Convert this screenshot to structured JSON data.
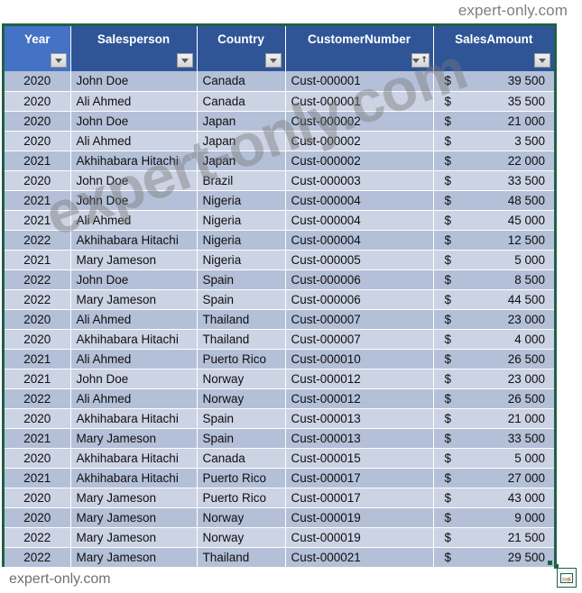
{
  "branding": {
    "top_watermark": "expert-only.com",
    "diagonal_watermark": "expert-only.com",
    "bottom_watermark": "expert-only.com"
  },
  "colors": {
    "header_blue": "#2F5597",
    "active_header_blue": "#4472C4",
    "band_dark": "#B4C0D8",
    "band_light": "#CCD3E4",
    "selection_border": "#1F6148"
  },
  "table": {
    "columns": [
      {
        "label": "Year",
        "key": "year",
        "filter": "filter-dropdown",
        "sorted": false,
        "active": true
      },
      {
        "label": "Salesperson",
        "key": "salesperson",
        "filter": "filter-dropdown",
        "sorted": false,
        "active": false
      },
      {
        "label": "Country",
        "key": "country",
        "filter": "filter-dropdown",
        "sorted": false,
        "active": false
      },
      {
        "label": "CustomerNumber",
        "key": "customer_number",
        "filter": "filter-dropdown-sorted-ascending",
        "sorted": true,
        "active": false
      },
      {
        "label": "SalesAmount",
        "key": "sales_amount",
        "filter": "filter-dropdown",
        "sorted": false,
        "active": false
      }
    ],
    "currency_symbol": "$",
    "rows": [
      {
        "year": "2020",
        "salesperson": "John Doe",
        "country": "Canada",
        "customer_number": "Cust-000001",
        "sales_amount": "39 500"
      },
      {
        "year": "2020",
        "salesperson": "Ali Ahmed",
        "country": "Canada",
        "customer_number": "Cust-000001",
        "sales_amount": "35 500"
      },
      {
        "year": "2020",
        "salesperson": "John Doe",
        "country": "Japan",
        "customer_number": "Cust-000002",
        "sales_amount": "21 000"
      },
      {
        "year": "2020",
        "salesperson": "Ali Ahmed",
        "country": "Japan",
        "customer_number": "Cust-000002",
        "sales_amount": "3 500"
      },
      {
        "year": "2021",
        "salesperson": "Akhihabara Hitachi",
        "country": "Japan",
        "customer_number": "Cust-000002",
        "sales_amount": "22 000"
      },
      {
        "year": "2020",
        "salesperson": "John Doe",
        "country": "Brazil",
        "customer_number": "Cust-000003",
        "sales_amount": "33 500"
      },
      {
        "year": "2021",
        "salesperson": "John Doe",
        "country": "Nigeria",
        "customer_number": "Cust-000004",
        "sales_amount": "48 500"
      },
      {
        "year": "2021",
        "salesperson": "Ali Ahmed",
        "country": "Nigeria",
        "customer_number": "Cust-000004",
        "sales_amount": "45 000"
      },
      {
        "year": "2022",
        "salesperson": "Akhihabara Hitachi",
        "country": "Nigeria",
        "customer_number": "Cust-000004",
        "sales_amount": "12 500"
      },
      {
        "year": "2021",
        "salesperson": "Mary Jameson",
        "country": "Nigeria",
        "customer_number": "Cust-000005",
        "sales_amount": "5 000"
      },
      {
        "year": "2022",
        "salesperson": "John Doe",
        "country": "Spain",
        "customer_number": "Cust-000006",
        "sales_amount": "8 500"
      },
      {
        "year": "2022",
        "salesperson": "Mary Jameson",
        "country": "Spain",
        "customer_number": "Cust-000006",
        "sales_amount": "44 500"
      },
      {
        "year": "2020",
        "salesperson": "Ali Ahmed",
        "country": "Thailand",
        "customer_number": "Cust-000007",
        "sales_amount": "23 000"
      },
      {
        "year": "2020",
        "salesperson": "Akhihabara Hitachi",
        "country": "Thailand",
        "customer_number": "Cust-000007",
        "sales_amount": "4 000"
      },
      {
        "year": "2021",
        "salesperson": "Ali Ahmed",
        "country": "Puerto Rico",
        "customer_number": "Cust-000010",
        "sales_amount": "26 500"
      },
      {
        "year": "2021",
        "salesperson": "John Doe",
        "country": "Norway",
        "customer_number": "Cust-000012",
        "sales_amount": "23 000"
      },
      {
        "year": "2022",
        "salesperson": "Ali Ahmed",
        "country": "Norway",
        "customer_number": "Cust-000012",
        "sales_amount": "26 500"
      },
      {
        "year": "2020",
        "salesperson": "Akhihabara Hitachi",
        "country": "Spain",
        "customer_number": "Cust-000013",
        "sales_amount": "21 000"
      },
      {
        "year": "2021",
        "salesperson": "Mary Jameson",
        "country": "Spain",
        "customer_number": "Cust-000013",
        "sales_amount": "33 500"
      },
      {
        "year": "2020",
        "salesperson": "Akhihabara Hitachi",
        "country": "Canada",
        "customer_number": "Cust-000015",
        "sales_amount": "5 000"
      },
      {
        "year": "2021",
        "salesperson": "Akhihabara Hitachi",
        "country": "Puerto Rico",
        "customer_number": "Cust-000017",
        "sales_amount": "27 000"
      },
      {
        "year": "2020",
        "salesperson": "Mary Jameson",
        "country": "Puerto Rico",
        "customer_number": "Cust-000017",
        "sales_amount": "43 000"
      },
      {
        "year": "2020",
        "salesperson": "Mary Jameson",
        "country": "Norway",
        "customer_number": "Cust-000019",
        "sales_amount": "9 000"
      },
      {
        "year": "2022",
        "salesperson": "Mary Jameson",
        "country": "Norway",
        "customer_number": "Cust-000019",
        "sales_amount": "21 500"
      },
      {
        "year": "2022",
        "salesperson": "Mary Jameson",
        "country": "Thailand",
        "customer_number": "Cust-000021",
        "sales_amount": "29 500"
      }
    ]
  },
  "quick_analysis": {
    "icon": "quick-analysis-icon"
  }
}
